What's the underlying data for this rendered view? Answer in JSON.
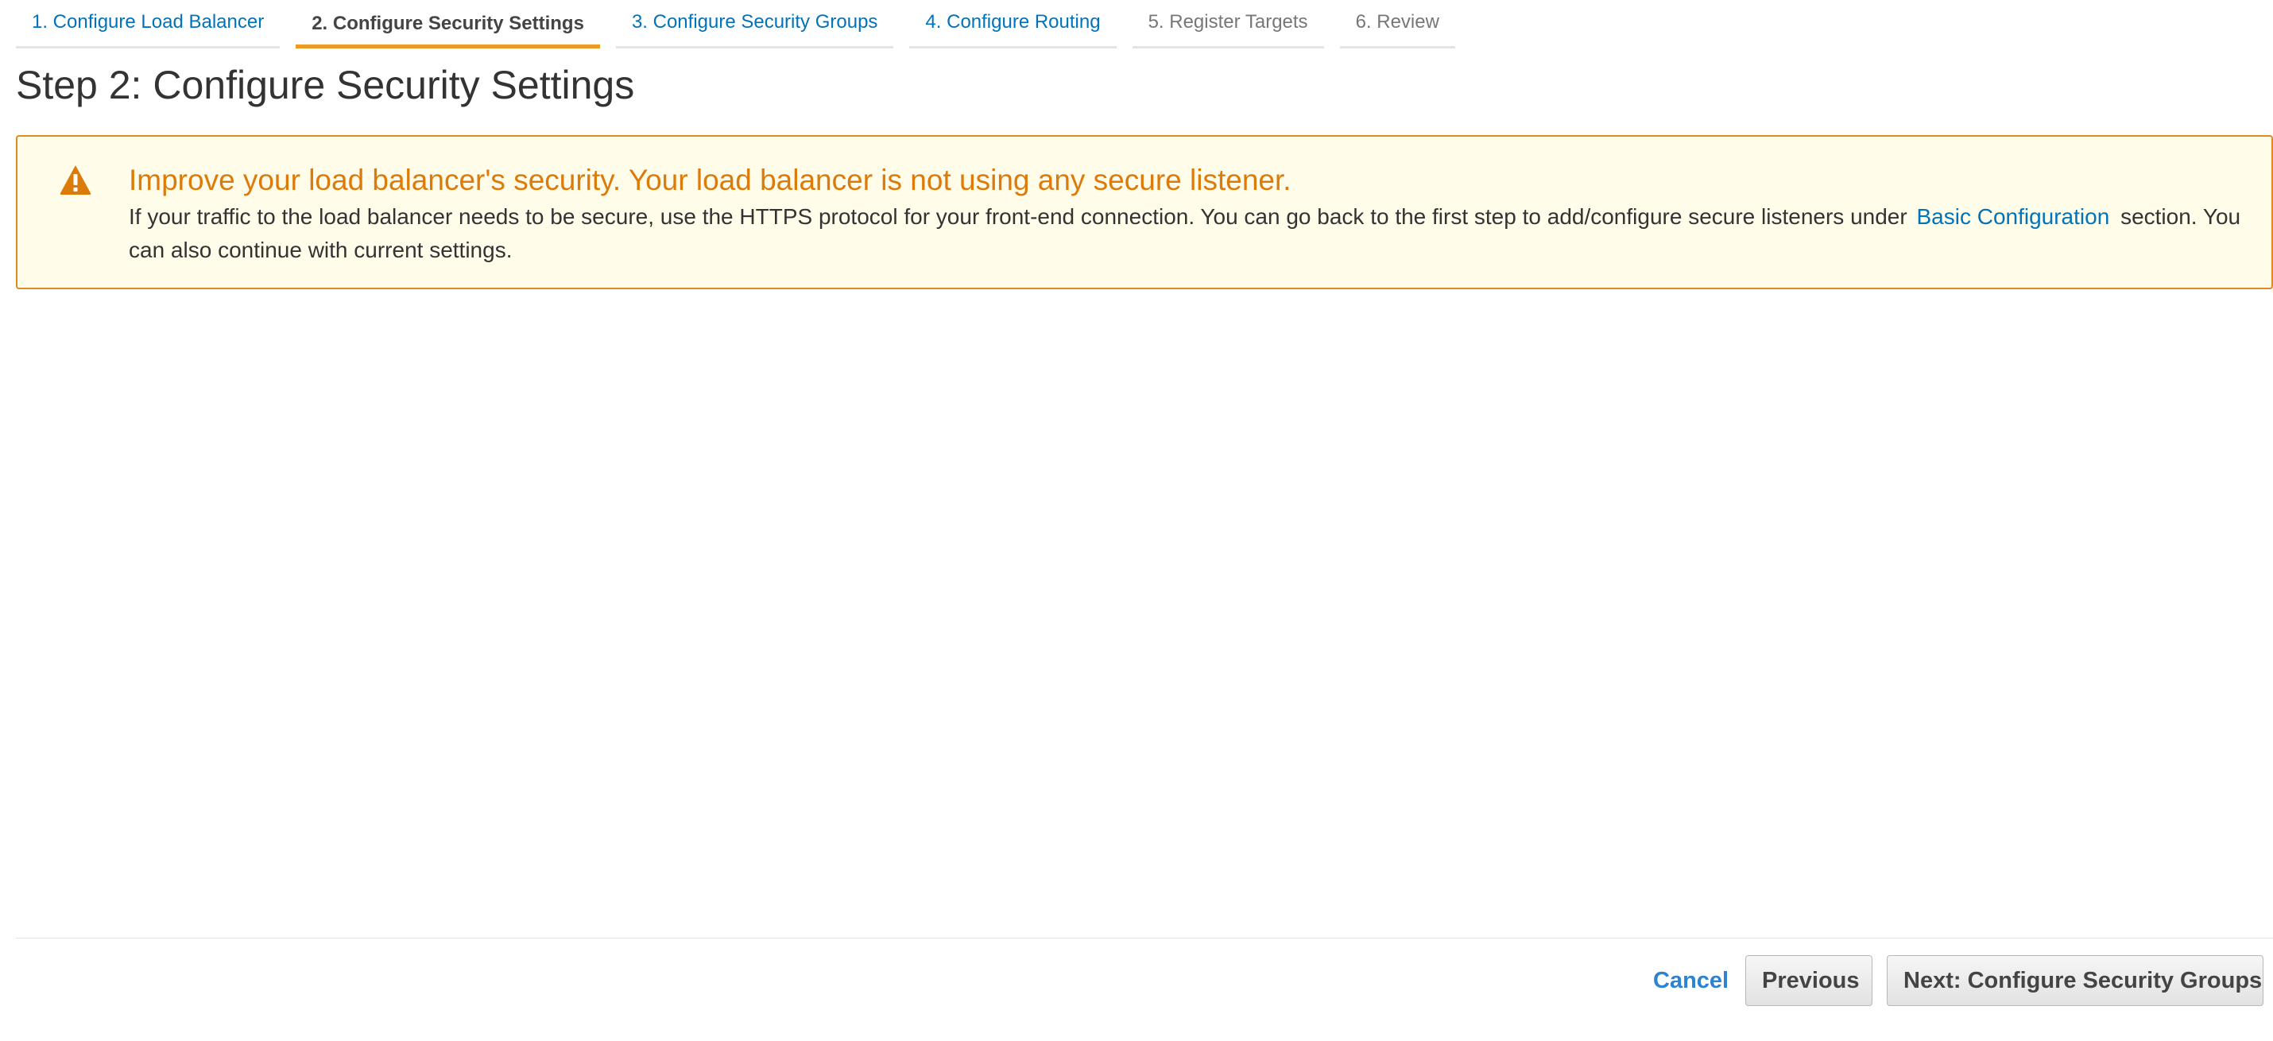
{
  "wizard": {
    "steps": [
      {
        "label": "1. Configure Load Balancer",
        "state": "link"
      },
      {
        "label": "2. Configure Security Settings",
        "state": "active"
      },
      {
        "label": "3. Configure Security Groups",
        "state": "link"
      },
      {
        "label": "4. Configure Routing",
        "state": "link"
      },
      {
        "label": "5. Register Targets",
        "state": "disabled"
      },
      {
        "label": "6. Review",
        "state": "disabled"
      }
    ]
  },
  "page": {
    "title": "Step 2: Configure Security Settings"
  },
  "alert": {
    "icon": "warning-triangle-icon",
    "title": "Improve your load balancer's security. Your load balancer is not using any secure listener.",
    "body_before": "If your traffic to the load balancer needs to be secure, use the HTTPS protocol for your front-end connection. You can go back to the first step to add/configure secure listeners under",
    "link_label": "Basic Configuration",
    "body_after": "section. You can also continue with current settings."
  },
  "footer": {
    "cancel_label": "Cancel",
    "previous_label": "Previous",
    "next_label": "Next: Configure Security Groups"
  },
  "colors": {
    "accent_orange": "#ec9c24",
    "link_blue": "#0073bb",
    "warning_text": "#dd7b0a",
    "warning_bg": "#fffcea",
    "warning_border": "#de8b24"
  }
}
